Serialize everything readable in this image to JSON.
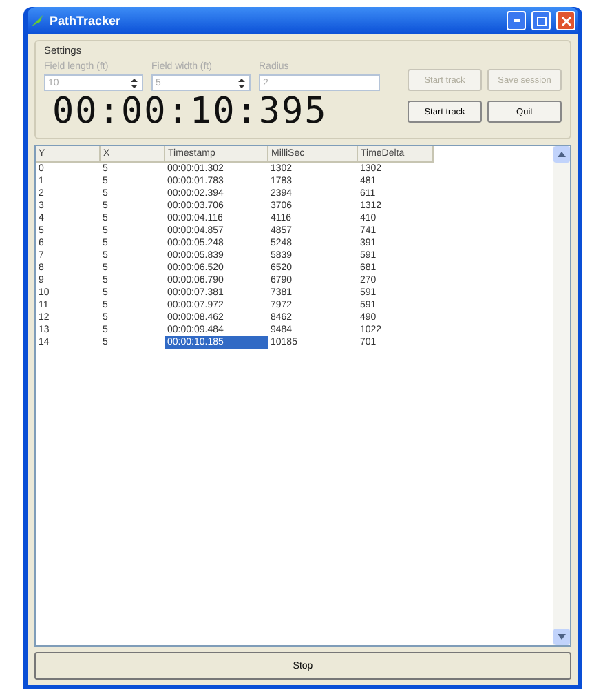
{
  "window": {
    "title": "PathTracker"
  },
  "settings": {
    "title": "Settings",
    "fields": [
      {
        "label": "Field length (ft)",
        "value": "10",
        "kind": "spin"
      },
      {
        "label": "Field width (ft)",
        "value": "5",
        "kind": "spin"
      },
      {
        "label": "Radius",
        "value": "2",
        "kind": "text"
      }
    ]
  },
  "buttons": [
    {
      "label": "Start track",
      "disabled": true
    },
    {
      "label": "Save session",
      "disabled": true
    },
    {
      "label": "Start track",
      "disabled": false
    },
    {
      "label": "Quit",
      "disabled": false
    }
  ],
  "timer": "00:00:10:395",
  "table": {
    "columns": [
      "Y",
      "X",
      "Timestamp",
      "MilliSec",
      "TimeDelta"
    ],
    "rows": [
      {
        "cells": [
          "0",
          "5",
          "00:00:01.302",
          "1302",
          "1302"
        ],
        "selected": false
      },
      {
        "cells": [
          "1",
          "5",
          "00:00:01.783",
          "1783",
          "481"
        ],
        "selected": false
      },
      {
        "cells": [
          "2",
          "5",
          "00:00:02.394",
          "2394",
          "611"
        ],
        "selected": false
      },
      {
        "cells": [
          "3",
          "5",
          "00:00:03.706",
          "3706",
          "1312"
        ],
        "selected": false
      },
      {
        "cells": [
          "4",
          "5",
          "00:00:04.116",
          "4116",
          "410"
        ],
        "selected": false
      },
      {
        "cells": [
          "5",
          "5",
          "00:00:04.857",
          "4857",
          "741"
        ],
        "selected": false
      },
      {
        "cells": [
          "6",
          "5",
          "00:00:05.248",
          "5248",
          "391"
        ],
        "selected": false
      },
      {
        "cells": [
          "7",
          "5",
          "00:00:05.839",
          "5839",
          "591"
        ],
        "selected": false
      },
      {
        "cells": [
          "8",
          "5",
          "00:00:06.520",
          "6520",
          "681"
        ],
        "selected": false
      },
      {
        "cells": [
          "9",
          "5",
          "00:00:06.790",
          "6790",
          "270"
        ],
        "selected": false
      },
      {
        "cells": [
          "10",
          "5",
          "00:00:07.381",
          "7381",
          "591"
        ],
        "selected": false
      },
      {
        "cells": [
          "11",
          "5",
          "00:00:07.972",
          "7972",
          "591"
        ],
        "selected": false
      },
      {
        "cells": [
          "12",
          "5",
          "00:00:08.462",
          "8462",
          "490"
        ],
        "selected": false
      },
      {
        "cells": [
          "13",
          "5",
          "00:00:09.484",
          "9484",
          "1022"
        ],
        "selected": false
      },
      {
        "cells": [
          "14",
          "5",
          "00:00:10.185",
          "10185",
          "701"
        ],
        "selected": true
      }
    ]
  },
  "stop_button": "Stop"
}
